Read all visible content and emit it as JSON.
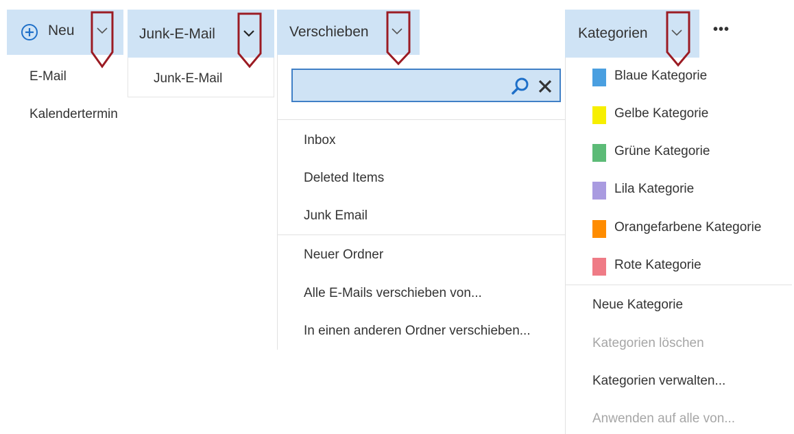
{
  "neu": {
    "label": "Neu",
    "items": [
      "E-Mail",
      "Kalendertermin"
    ]
  },
  "junk": {
    "label": "Junk-E-Mail",
    "items": [
      "Junk-E-Mail"
    ]
  },
  "verschieben": {
    "label": "Verschieben",
    "search_value": "",
    "folders": [
      "Inbox",
      "Deleted Items",
      "Junk Email"
    ],
    "actions": [
      "Neuer Ordner",
      "Alle E-Mails verschieben von...",
      "In einen anderen Ordner verschieben..."
    ]
  },
  "kategorien": {
    "label": "Kategorien",
    "more_label": "•••",
    "categories": [
      {
        "label": "Blaue Kategorie",
        "color": "#4a9fe0"
      },
      {
        "label": "Gelbe Kategorie",
        "color": "#f7ef00"
      },
      {
        "label": "Grüne Kategorie",
        "color": "#5cbb77"
      },
      {
        "label": "Lila Kategorie",
        "color": "#a99be0"
      },
      {
        "label": "Orangefarbene Kategorie",
        "color": "#ff8c00"
      },
      {
        "label": "Rote Kategorie",
        "color": "#ef7b86"
      }
    ],
    "actions": [
      {
        "label": "Neue Kategorie",
        "enabled": true
      },
      {
        "label": "Kategorien löschen",
        "enabled": false
      },
      {
        "label": "Kategorien verwalten...",
        "enabled": true
      },
      {
        "label": "Anwenden auf alle von...",
        "enabled": false
      }
    ]
  },
  "colors": {
    "toolbar_bg": "#cfe3f5",
    "accent_blue": "#1e6fc8",
    "marker_red": "#9b1b23"
  },
  "icons": [
    "plus-circle-icon",
    "chevron-down-icon",
    "search-icon",
    "close-icon",
    "more-icon"
  ]
}
